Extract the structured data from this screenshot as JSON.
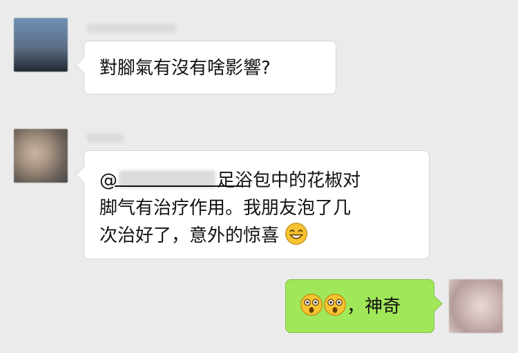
{
  "chat": {
    "messages": [
      {
        "sender": "other",
        "text": "對腳氣有沒有啥影響?"
      },
      {
        "sender": "other",
        "mention_prefix": "@",
        "line1_after_mention": "足浴包中的花椒对",
        "line2": "脚气有治疗作用。我朋友泡了几",
        "line3": "次治好了，意外的惊喜",
        "emoji": "grinning-face-icon"
      },
      {
        "sender": "self",
        "text": "，神奇",
        "emojis": [
          "astonished-face-icon",
          "astonished-face-icon"
        ]
      }
    ]
  },
  "colors": {
    "background": "#ebebeb",
    "incoming_bubble": "#ffffff",
    "outgoing_bubble": "#a0e759",
    "emoji_yellow": "#f6c431"
  }
}
